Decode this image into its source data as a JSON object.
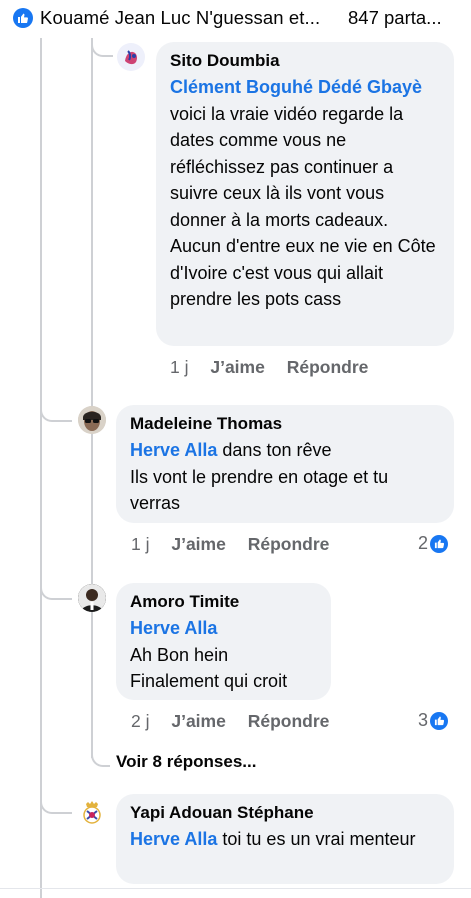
{
  "header": {
    "title": "Kouamé Jean Luc N'guessan et...",
    "shares": "847 parta..."
  },
  "comments": [
    {
      "author": "Sito Doumbia",
      "mention": "Clément Boguhé Dédé Gbayè",
      "text": "voici la vraie vidéo regarde la dates comme vous ne réfléchissez pas continuer a suivre ceux là ils vont vous donner à la morts cadeaux. Aucun d'entre eux ne vie en Côte d'Ivoire c'est vous qui allait prendre les pots cass",
      "time": "1 j",
      "like_label": "J’aime",
      "reply_label": "Répondre"
    },
    {
      "author": "Madeleine Thomas",
      "mention": "Herve Alla",
      "text_line1": "dans ton rêve",
      "text_rest": "Ils vont le prendre en otage et tu verras",
      "time": "1 j",
      "like_label": "J’aime",
      "reply_label": "Répondre",
      "reactions": "2"
    },
    {
      "author": "Amoro Timite",
      "mention": "Herve Alla",
      "line1": "Ah Bon hein",
      "line2": "Finalement qui croit",
      "time": "2 j",
      "like_label": "J’aime",
      "reply_label": "Répondre",
      "reactions": "3"
    },
    {
      "author": "Yapi Adouan Stéphane",
      "mention": "Herve Alla",
      "text": "toi tu es un vrai menteur"
    }
  ],
  "more_replies": "Voir 8 réponses...",
  "colors": {
    "accent": "#1877f2",
    "mention": "#1b74e4",
    "bubble": "#f0f2f5",
    "muted": "#65676b",
    "thread_line": "#ced0d4"
  }
}
